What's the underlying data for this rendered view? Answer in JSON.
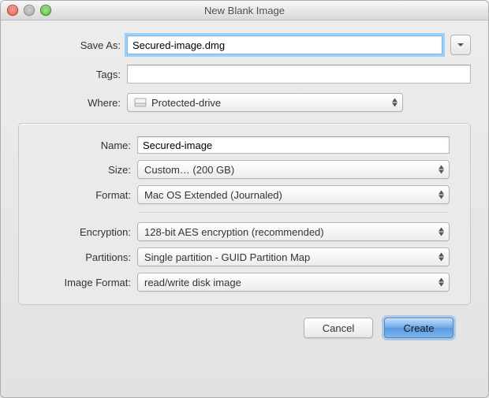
{
  "window": {
    "title": "New Blank Image"
  },
  "labels": {
    "saveAs": "Save As:",
    "tags": "Tags:",
    "where": "Where:",
    "name": "Name:",
    "size": "Size:",
    "format": "Format:",
    "encryption": "Encryption:",
    "partitions": "Partitions:",
    "imageFormat": "Image Format:"
  },
  "values": {
    "saveAs": "Secured-image.dmg",
    "tags": "",
    "where": "Protected-drive",
    "name": "Secured-image",
    "size": "Custom… (200 GB)",
    "format": "Mac OS Extended (Journaled)",
    "encryption": "128-bit AES encryption (recommended)",
    "partitions": "Single partition - GUID Partition Map",
    "imageFormat": "read/write disk image"
  },
  "buttons": {
    "cancel": "Cancel",
    "create": "Create"
  }
}
